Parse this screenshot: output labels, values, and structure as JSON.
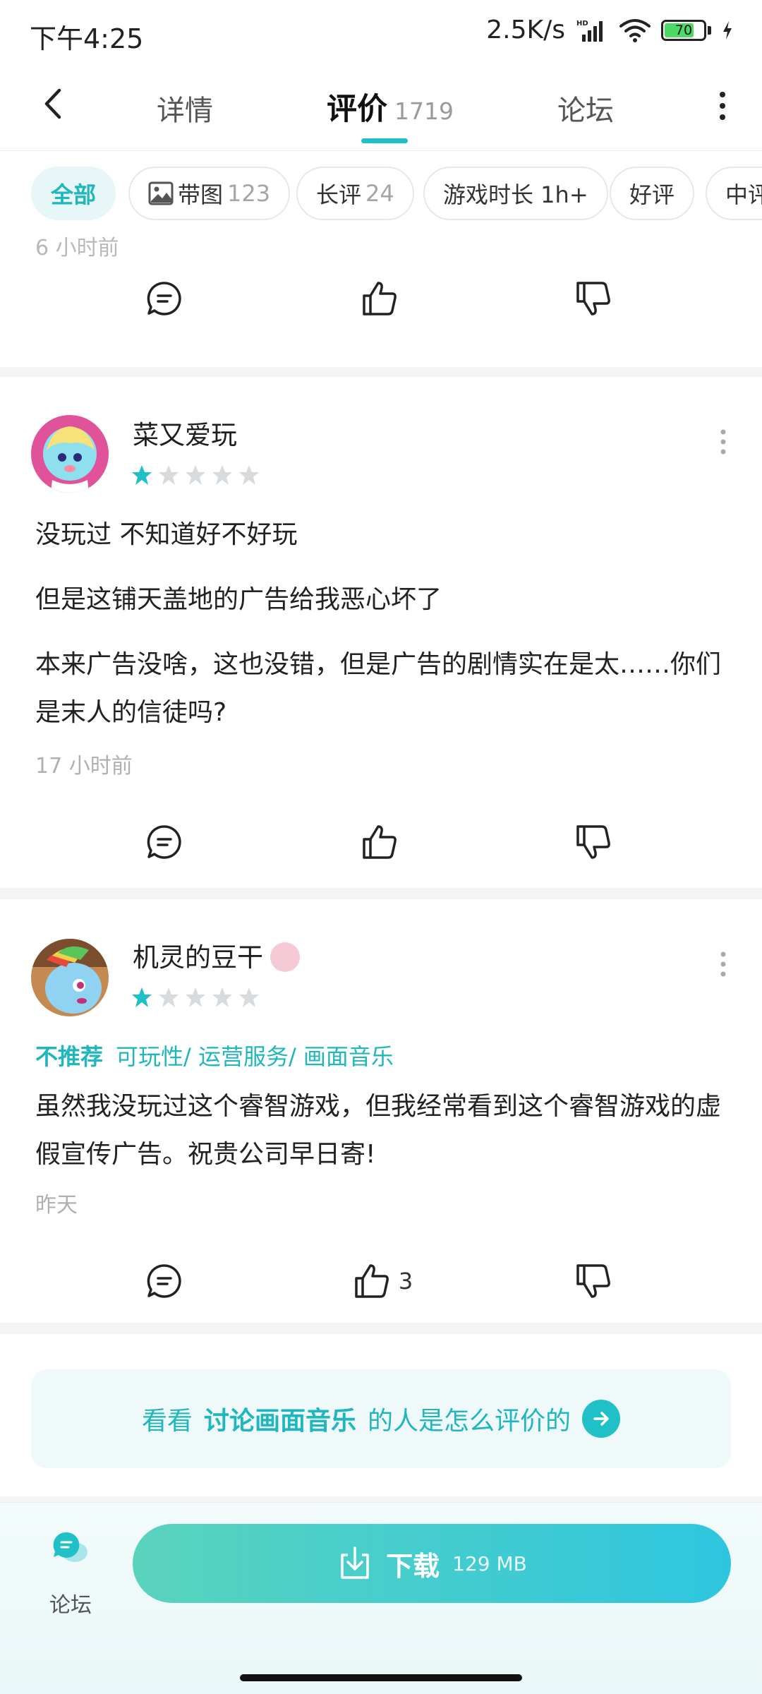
{
  "status_bar": {
    "time": "下午4:25",
    "net_speed": "2.5K/s",
    "battery": "70",
    "icons": [
      "hd-signal-icon",
      "wifi-icon",
      "battery-icon",
      "charging-icon"
    ]
  },
  "nav": {
    "tabs": [
      {
        "label": "详情"
      },
      {
        "label": "评价",
        "count": "1719"
      },
      {
        "label": "论坛"
      }
    ],
    "active_tab": "评价"
  },
  "filters": [
    {
      "label": "全部",
      "count": "",
      "active": true
    },
    {
      "label": "带图",
      "count": "123",
      "icon": "image-icon"
    },
    {
      "label": "长评",
      "count": "24"
    },
    {
      "label": "游戏时长 1h+",
      "count": ""
    },
    {
      "label": "好评",
      "count": ""
    },
    {
      "label": "中评",
      "count": ""
    }
  ],
  "top_card": {
    "time": "6 小时前"
  },
  "reviews": [
    {
      "user": "菜又爱玩",
      "rating": 1,
      "max_rating": 5,
      "paragraphs": [
        "没玩过 不知道好不好玩",
        "但是这铺天盖地的广告给我恶心坏了",
        "本来广告没啥，这也没错，但是广告的剧情实在是太……你们是末人的信徒吗?"
      ],
      "time": "17 小时前",
      "likes": ""
    },
    {
      "user": "机灵的豆干",
      "rating": 1,
      "max_rating": 5,
      "tags": {
        "verdict": "不推荐",
        "aspects": "可玩性/ 运营服务/ 画面音乐"
      },
      "paragraphs": [
        "虽然我没玩过这个睿智游戏，但我经常看到这个睿智游戏的虚假宣传广告。祝贵公司早日寄!"
      ],
      "time": "昨天",
      "likes": "3"
    }
  ],
  "suggest": {
    "prefix": "看看",
    "topic": "讨论画面音乐",
    "suffix": "的人是怎么评价的"
  },
  "bottom": {
    "forum_label": "论坛",
    "download_label": "下载",
    "download_size": "129 MB"
  },
  "colors": {
    "accent": "#1fc0c6",
    "star_on": "#1fc0c6",
    "star_off": "#d8dbdd"
  }
}
